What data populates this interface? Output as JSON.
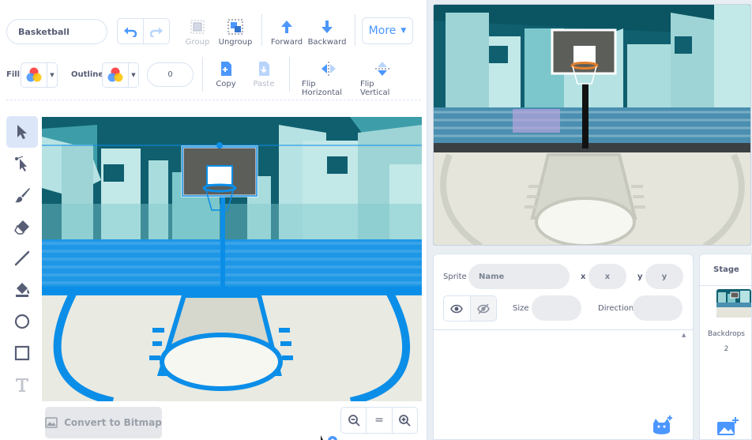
{
  "editor": {
    "costume_name": "Basketball",
    "toolbar": {
      "group_label": "Group",
      "ungroup_label": "Ungroup",
      "forward_label": "Forward",
      "backward_label": "Backward",
      "more_label": "More",
      "fill_label": "Fill",
      "outline_label": "Outline",
      "outline_width": "0",
      "copy_label": "Copy",
      "paste_label": "Paste",
      "flip_horizontal_label": "Flip Horizontal",
      "flip_vertical_label": "Flip Vertical"
    },
    "tools": [
      "select-icon",
      "reshape-icon",
      "brush-icon",
      "eraser-icon",
      "line-icon",
      "fill-icon",
      "circle-icon",
      "rectangle-icon",
      "text-icon"
    ],
    "convert_label": "Convert to Bitmap",
    "zoom_reset_label": "="
  },
  "sprite_info": {
    "sprite_label": "Sprite",
    "name_placeholder": "Name",
    "x_label": "x",
    "x_placeholder": "x",
    "y_label": "y",
    "y_placeholder": "y",
    "size_label": "Size",
    "direction_label": "Direction"
  },
  "stage_selector": {
    "stage_label": "Stage",
    "backdrops_label": "Backdrops",
    "backdrops_count": "2"
  },
  "colors": {
    "accent": "#4c97ff",
    "selection": "#0b8ee8",
    "text": "#575e75",
    "teal_dark": "#0f5f6f",
    "teal_light": "#8fd3d5"
  }
}
